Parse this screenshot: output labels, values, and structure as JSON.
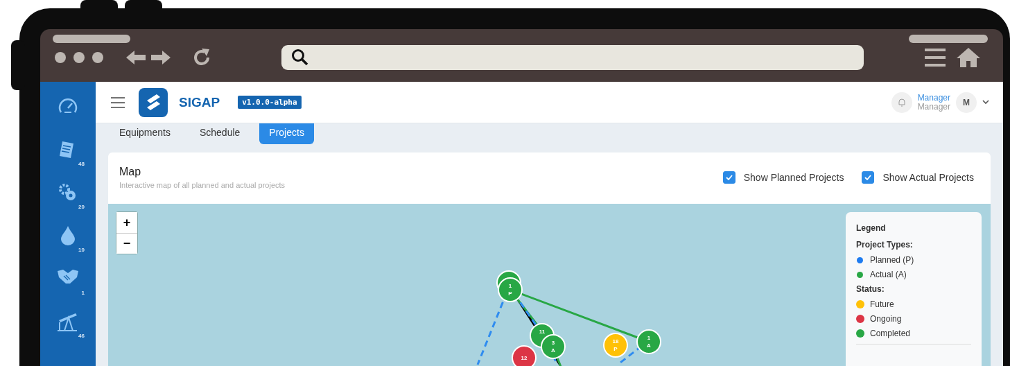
{
  "app": {
    "name": "SIGAP",
    "version": "v1.0.0-alpha"
  },
  "user": {
    "name": "Manager",
    "role": "Manager",
    "initial": "M"
  },
  "sidebar": {
    "items": [
      {
        "kind": "gauge"
      },
      {
        "kind": "document",
        "count": "48"
      },
      {
        "kind": "gears",
        "count": "20"
      },
      {
        "kind": "drop",
        "count": "10"
      },
      {
        "kind": "handshake",
        "count": "1"
      },
      {
        "kind": "pumpjack",
        "count": "46"
      }
    ]
  },
  "tabs": [
    {
      "label": "Equipments",
      "selected": false
    },
    {
      "label": "Schedule",
      "selected": false
    },
    {
      "label": "Projects",
      "selected": true
    }
  ],
  "card": {
    "title": "Map",
    "subtitle": "Interactive map of all planned and actual projects"
  },
  "filters": [
    {
      "label": "Show Planned Projects",
      "checked": true
    },
    {
      "label": "Show Actual Projects",
      "checked": true
    }
  ],
  "zoom": {
    "in": "+",
    "out": "−"
  },
  "markers": [
    {
      "color": "#28a745"
    },
    {
      "number": "1",
      "type": "P",
      "color": "#28a745"
    },
    {
      "number": "11",
      "color": "#28a745"
    },
    {
      "number": "3",
      "type": "A",
      "color": "#28a745"
    },
    {
      "number": "18",
      "type": "P",
      "color": "#ffc107"
    },
    {
      "number": "1",
      "type": "A",
      "color": "#28a745"
    },
    {
      "number": "12",
      "color": "#dc3545"
    }
  ],
  "legend": {
    "title": "Legend",
    "sections": [
      {
        "heading": "Project Types:",
        "items": [
          {
            "label": "Planned (P)",
            "color": "#1e7bf0"
          },
          {
            "label": "Actual (A)",
            "color": "#28a745"
          }
        ]
      },
      {
        "heading": "Status:",
        "items": [
          {
            "label": "Future",
            "color": "#ffc107"
          },
          {
            "label": "Ongoing",
            "color": "#dc3545"
          },
          {
            "label": "Completed",
            "color": "#28a745"
          }
        ]
      }
    ]
  }
}
